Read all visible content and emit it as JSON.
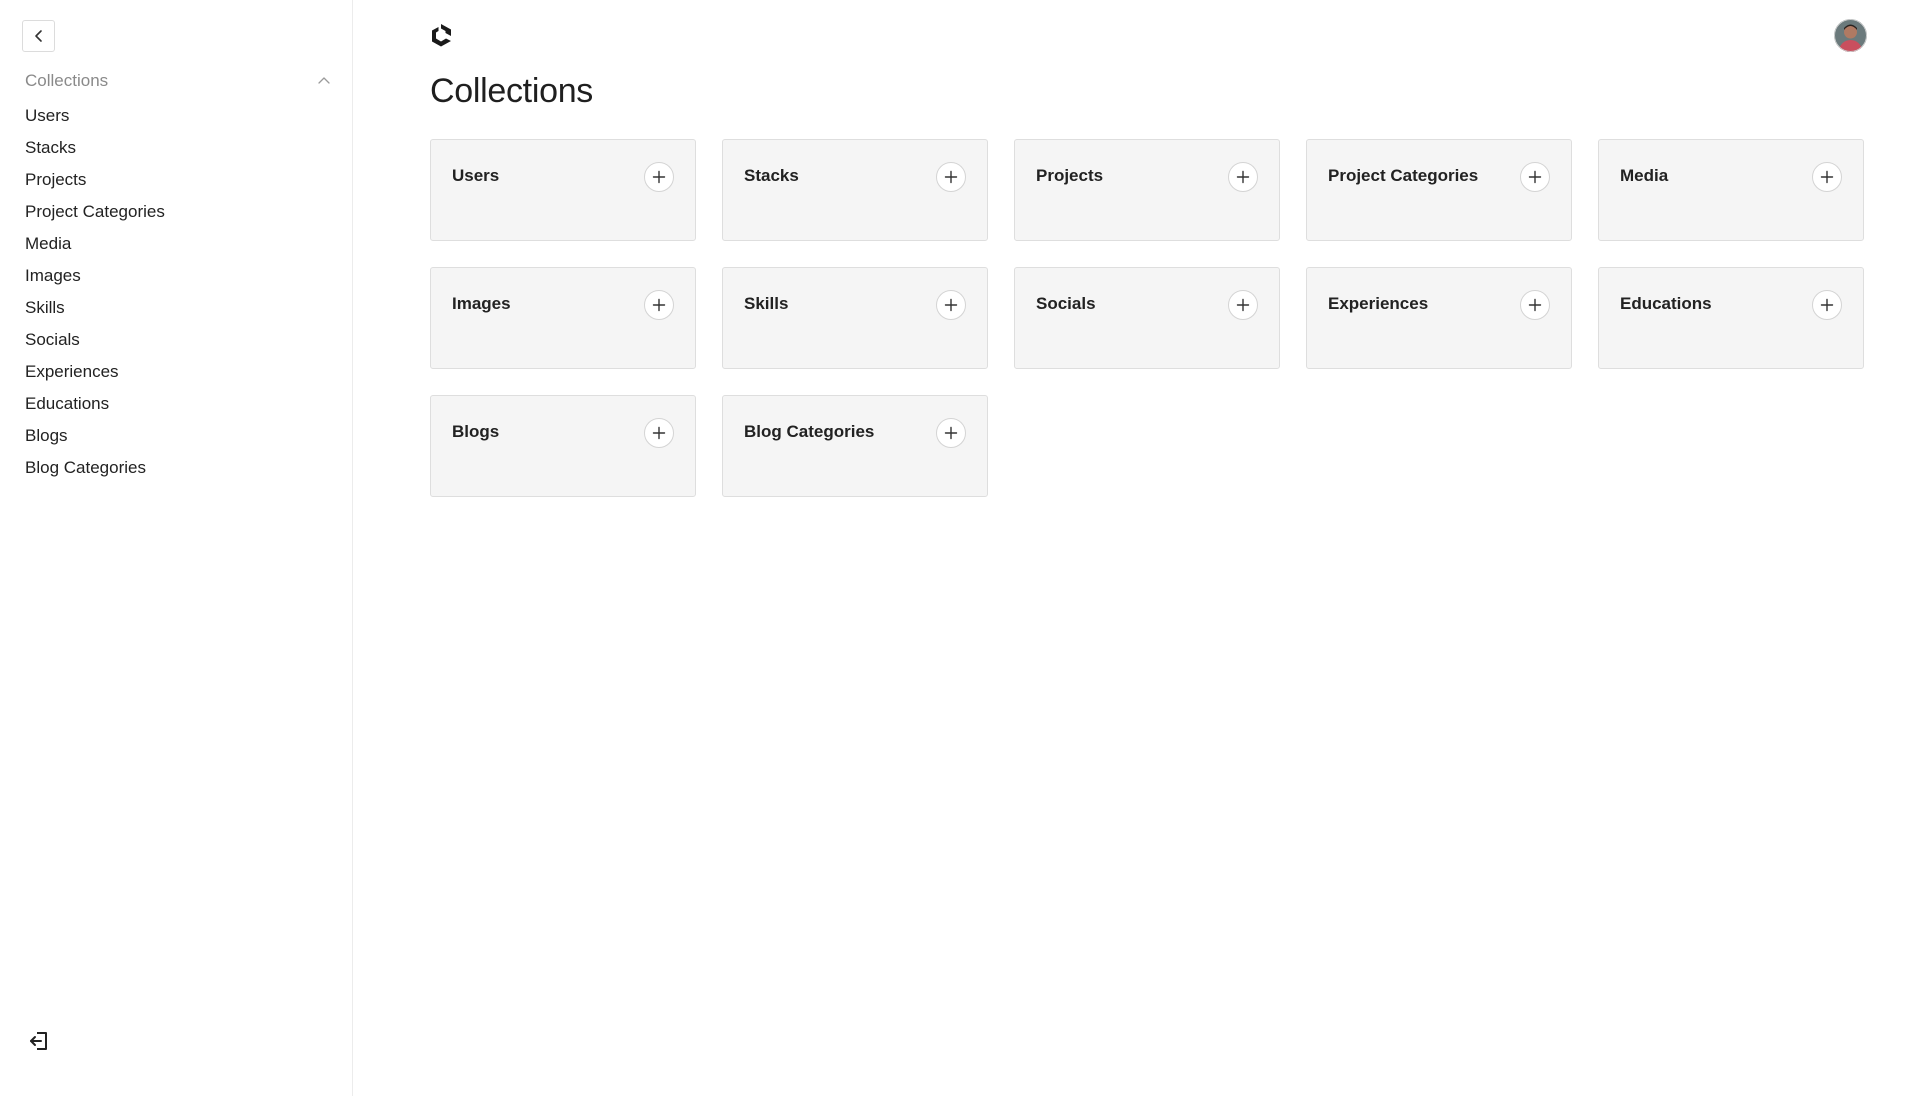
{
  "sidebar": {
    "back_icon": "chevron-left-icon",
    "group": {
      "label": "Collections",
      "toggle_icon": "chevron-up-icon",
      "items": [
        {
          "label": "Users"
        },
        {
          "label": "Stacks"
        },
        {
          "label": "Projects"
        },
        {
          "label": "Project Categories"
        },
        {
          "label": "Media"
        },
        {
          "label": "Images"
        },
        {
          "label": "Skills"
        },
        {
          "label": "Socials"
        },
        {
          "label": "Experiences"
        },
        {
          "label": "Educations"
        },
        {
          "label": "Blogs"
        },
        {
          "label": "Blog Categories"
        }
      ]
    },
    "logout_icon": "logout-icon"
  },
  "header": {
    "logo_icon": "payload-logo-icon",
    "avatar": "user-avatar"
  },
  "main": {
    "title": "Collections",
    "cards": [
      {
        "label": "Users"
      },
      {
        "label": "Stacks"
      },
      {
        "label": "Projects"
      },
      {
        "label": "Project Categories"
      },
      {
        "label": "Media"
      },
      {
        "label": "Images"
      },
      {
        "label": "Skills"
      },
      {
        "label": "Socials"
      },
      {
        "label": "Experiences"
      },
      {
        "label": "Educations"
      },
      {
        "label": "Blogs"
      },
      {
        "label": "Blog Categories"
      }
    ],
    "card_add_icon": "plus-icon"
  },
  "colors": {
    "card_background": "#f5f5f5",
    "card_border": "#dedede",
    "muted_text": "#8a8a8a",
    "text": "#222222"
  }
}
